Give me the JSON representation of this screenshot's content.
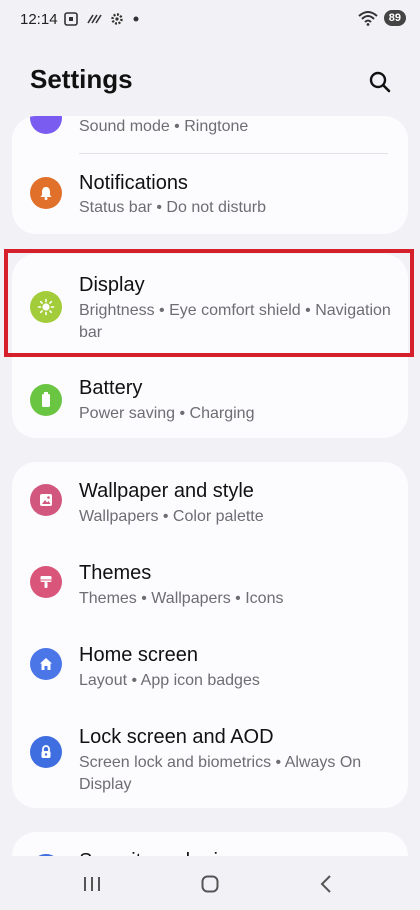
{
  "status_bar": {
    "time": "12:14",
    "battery": "89",
    "icons": [
      "screenshot-icon",
      "signal-slash-icon",
      "settings-gear-icon",
      "dot-icon",
      "wifi-icon"
    ]
  },
  "header": {
    "title": "Settings"
  },
  "group1": {
    "items": [
      {
        "subtitle": "Sound mode  •  Ringtone",
        "icon_color": "#7b5cf0"
      },
      {
        "title": "Notifications",
        "subtitle": "Status bar  •  Do not disturb",
        "icon_color": "#e0702a"
      }
    ]
  },
  "group2": {
    "items": [
      {
        "title": "Display",
        "subtitle": "Brightness  •  Eye comfort shield  •  Navigation bar",
        "icon_color": "#a3cc3a"
      },
      {
        "title": "Battery",
        "subtitle": "Power saving  •  Charging",
        "icon_color": "#6ac642"
      }
    ]
  },
  "group3": {
    "items": [
      {
        "title": "Wallpaper and style",
        "subtitle": "Wallpapers  •  Color palette",
        "icon_color": "#d2577f"
      },
      {
        "title": "Themes",
        "subtitle": "Themes  •  Wallpapers  •  Icons",
        "icon_color": "#d9557a"
      },
      {
        "title": "Home screen",
        "subtitle": "Layout  •  App icon badges",
        "icon_color": "#4a76e8"
      },
      {
        "title": "Lock screen and AOD",
        "subtitle": "Screen lock and biometrics  •  Always On Display",
        "icon_color": "#3f6ee0"
      }
    ]
  },
  "group4": {
    "items": [
      {
        "title": "Security and privacy"
      }
    ]
  }
}
